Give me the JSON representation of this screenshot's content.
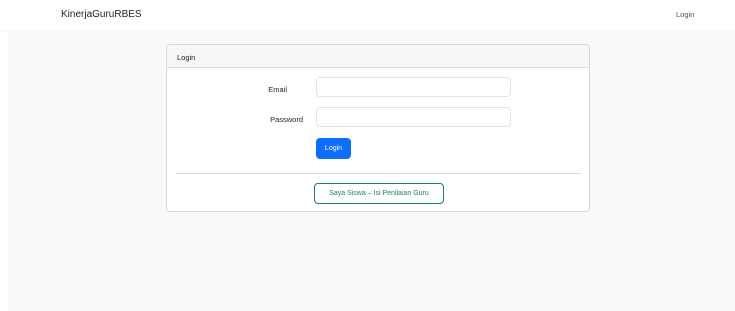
{
  "navbar": {
    "brand": "KinerjaGuruRBES",
    "login_link": "Login"
  },
  "card": {
    "header": "Login",
    "email_label": "Email",
    "email_value": "",
    "password_label": "Password",
    "password_value": "",
    "login_button": "Login",
    "student_button": "Saya Siswa – Isi Penilaian Guru"
  },
  "colors": {
    "primary": "#0d6efd",
    "success": "#198754",
    "page_background": "#f8f9fa"
  }
}
